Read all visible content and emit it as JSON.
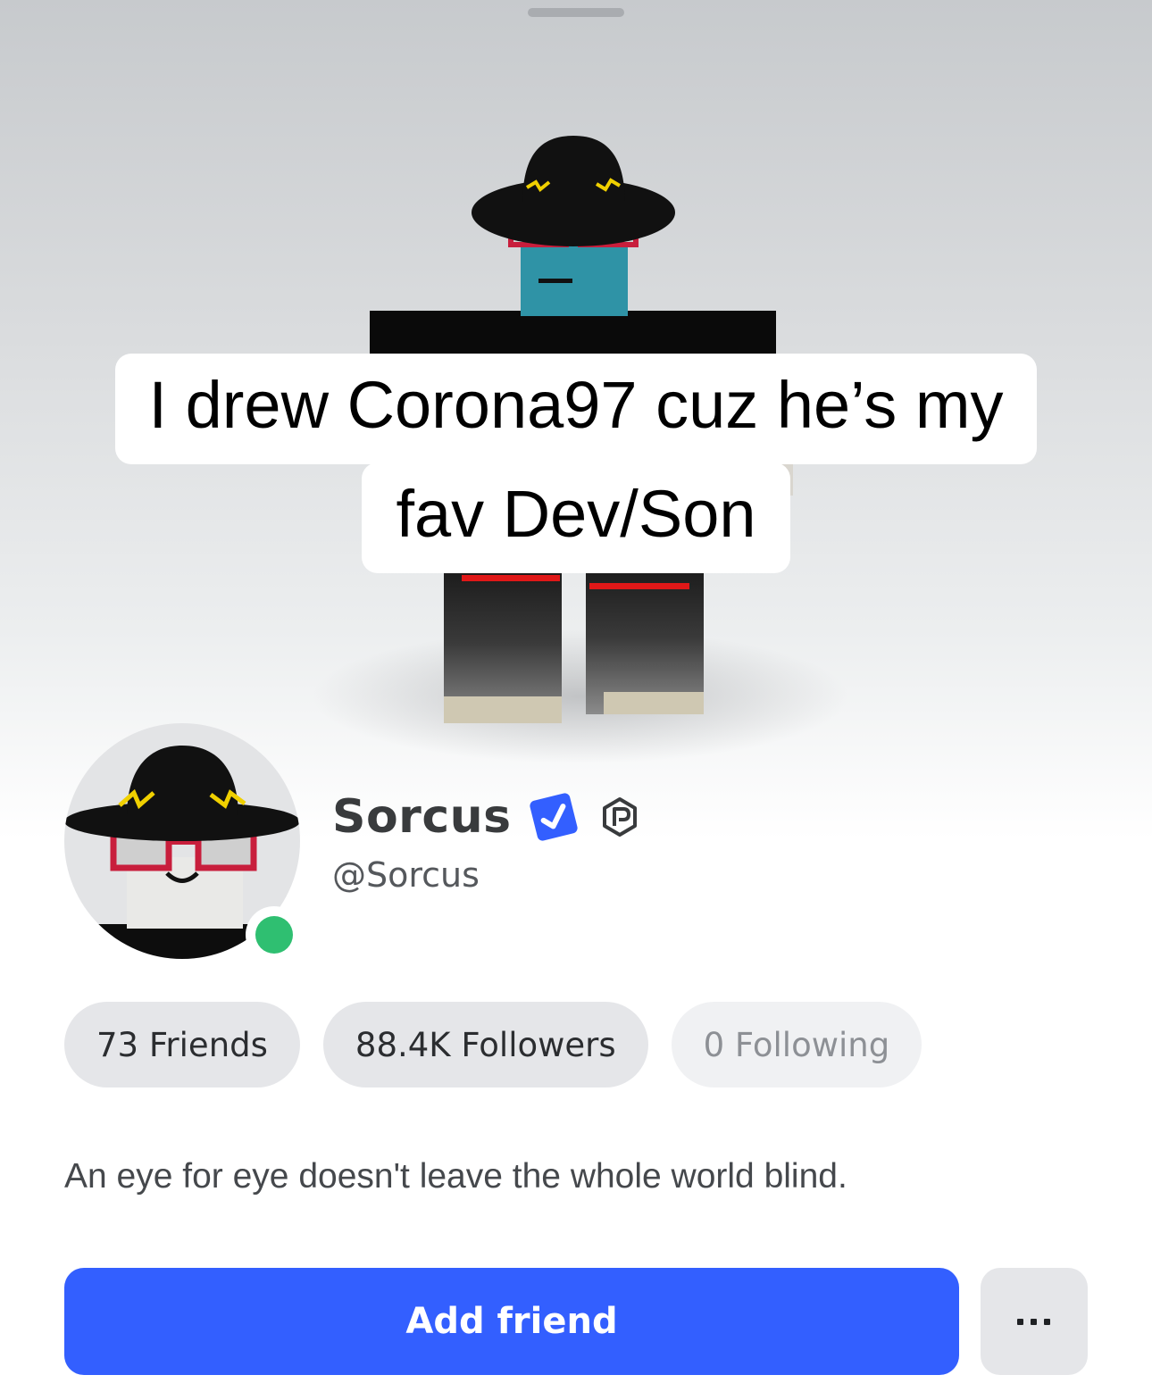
{
  "caption": {
    "line1": "I drew Corona97 cuz he’s my",
    "line2": "fav Dev/Son"
  },
  "profile": {
    "display_name": "Sorcus",
    "username": "@Sorcus",
    "verified": true,
    "online": true,
    "bio": "An eye for eye doesn't leave the whole world blind."
  },
  "stats": {
    "friends": "73 Friends",
    "followers": "88.4K Followers",
    "following": "0 Following"
  },
  "actions": {
    "add_friend_label": "Add friend",
    "more_icon": "more-horizontal-icon"
  },
  "colors": {
    "primary_button": "#335fff",
    "verified_badge": "#335fff",
    "online_status": "#2fbf71"
  }
}
